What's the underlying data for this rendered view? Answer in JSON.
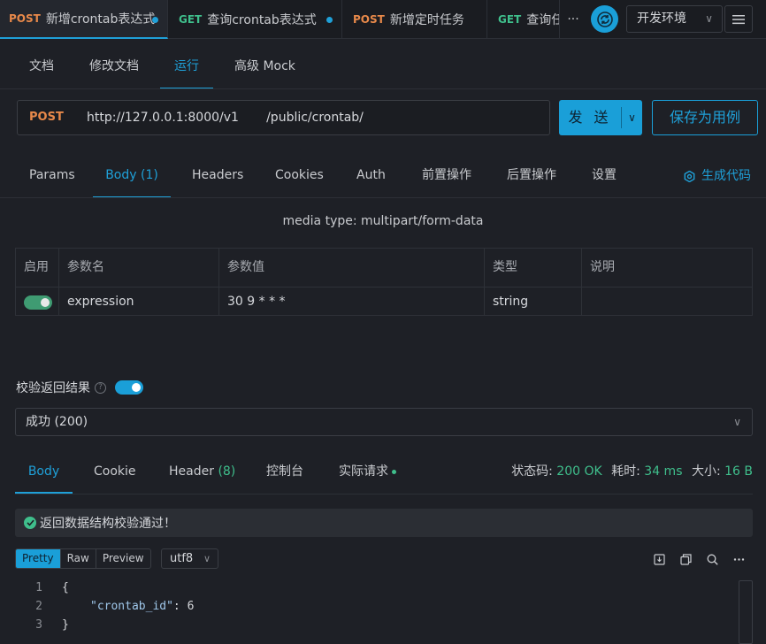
{
  "request_tabs": [
    {
      "method": "POST",
      "title": "新增crontab表达式",
      "modified": true
    },
    {
      "method": "GET",
      "title": "查询crontab表达式",
      "modified": true
    },
    {
      "method": "POST",
      "title": "新增定时任务",
      "modified": false
    },
    {
      "method": "GET",
      "title": "查询任务",
      "modified": false
    }
  ],
  "more_label": "···",
  "environment": "开发环境",
  "doc_tabs": [
    "文档",
    "修改文档",
    "运行",
    "高级 Mock"
  ],
  "active_doc_tab": "运行",
  "request": {
    "method": "POST",
    "url": "http://127.0.0.1:8000/v1       /public/crontab/",
    "send_label": "发 送",
    "save_label": "保存为用例"
  },
  "param_tabs": [
    "Params",
    "Body (1)",
    "Headers",
    "Cookies",
    "Auth",
    "前置操作",
    "后置操作",
    "设置"
  ],
  "active_param_tab": "Body (1)",
  "generate_code_label": "生成代码",
  "media_type": "media type: multipart/form-data",
  "body_table": {
    "headers": [
      "启用",
      "参数名",
      "参数值",
      "类型",
      "说明"
    ],
    "rows": [
      {
        "enabled": true,
        "name": "expression",
        "value": "30 9 * * *",
        "type": "string",
        "description": ""
      }
    ]
  },
  "validate": {
    "label": "校验返回结果",
    "enabled": true,
    "selected": "成功 (200)"
  },
  "response_tabs": {
    "body": "Body",
    "cookie": "Cookie",
    "header": "Header",
    "header_count": "(8)",
    "console": "控制台",
    "actual_request": "实际请求"
  },
  "response_meta": {
    "status_label": "状态码:",
    "status_value": "200 OK",
    "time_label": "耗时:",
    "time_value": "34 ms",
    "size_label": "大小:",
    "size_value": "16 B"
  },
  "validation_message": "返回数据结构校验通过！",
  "format_buttons": [
    "Pretty",
    "Raw",
    "Preview"
  ],
  "active_format": "Pretty",
  "encoding": "utf8",
  "code_lines": [
    {
      "num": "1",
      "text": "{"
    },
    {
      "num": "2",
      "key": "\"crontab_id\"",
      "sep": ": ",
      "value": "6"
    },
    {
      "num": "3",
      "text": "}"
    }
  ],
  "colors": {
    "accent": "#1fa0d8",
    "post": "#e8894a",
    "get": "#3fbf8c",
    "success": "#3fbf8c"
  }
}
